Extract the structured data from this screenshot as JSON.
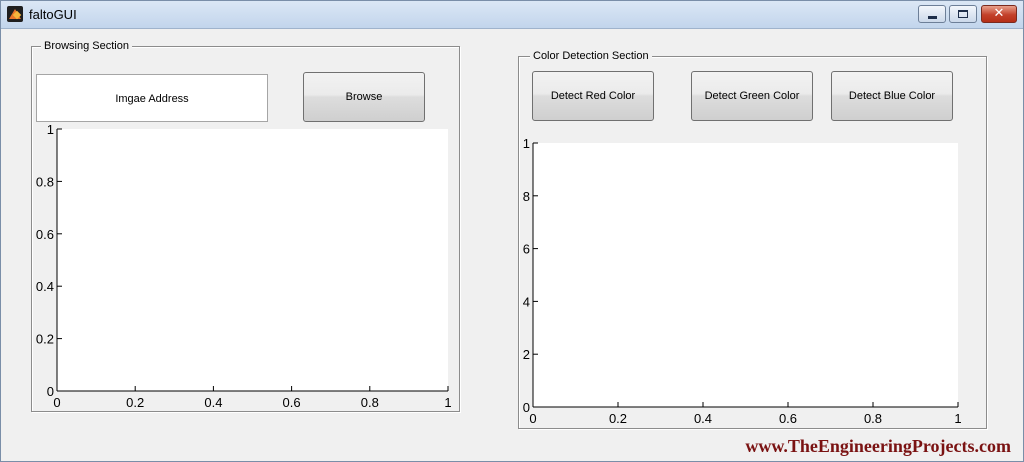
{
  "window": {
    "title": "faltoGUI",
    "icon": "matlab-icon",
    "controls": {
      "minimize": "minimize-icon",
      "maximize": "maximize-icon",
      "close": "✕"
    }
  },
  "browse_section": {
    "title": "Browsing Section",
    "address_field": "Imgae Address",
    "browse_button": "Browse"
  },
  "detect_section": {
    "title": "Color Detection Section",
    "red_button": "Detect Red Color",
    "green_button": "Detect Green Color",
    "blue_button": "Detect Blue Color"
  },
  "chart_data": [
    {
      "type": "scatter",
      "x": [],
      "y": [],
      "xlim": [
        0,
        1
      ],
      "ylim": [
        0,
        1
      ],
      "xticks": [
        "0",
        "0.2",
        "0.4",
        "0.6",
        "0.8",
        "1"
      ],
      "yticks": [
        "0",
        "0.2",
        "0.4",
        "0.6",
        "0.8",
        "1"
      ],
      "grid": false
    },
    {
      "type": "scatter",
      "x": [],
      "y": [],
      "xlim": [
        0,
        1
      ],
      "ylim": [
        0,
        1
      ],
      "xticks": [
        "0",
        "0.2",
        "0.4",
        "0.6",
        "0.8",
        "1"
      ],
      "yticks": [
        "0",
        "2",
        "4",
        "6",
        "8",
        "1"
      ],
      "grid": false
    }
  ],
  "watermark": "www.TheEngineeringProjects.com"
}
